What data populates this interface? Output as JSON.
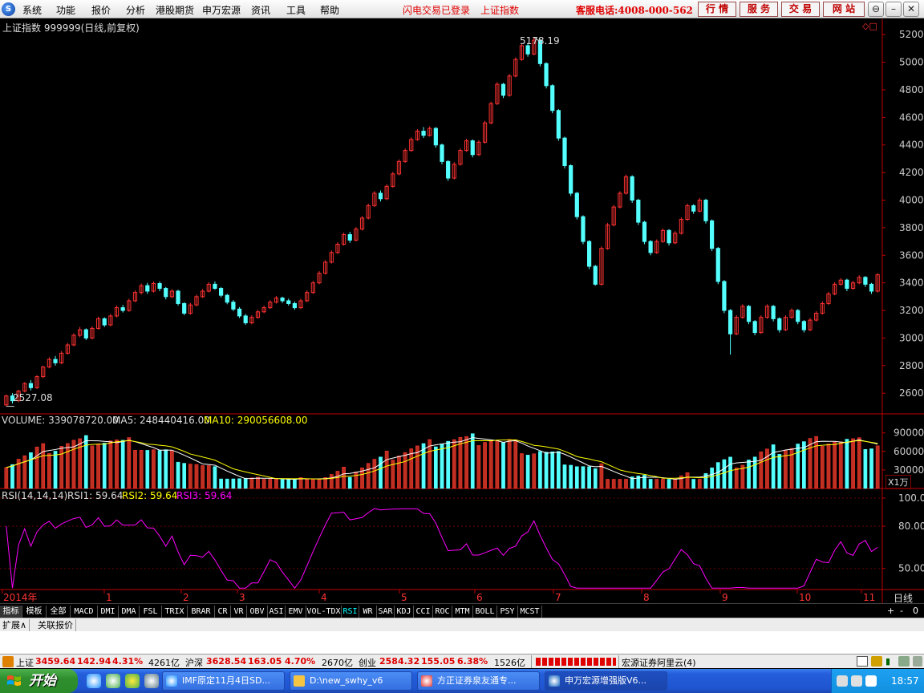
{
  "menubar": {
    "menus": [
      "系统",
      "功能",
      "报价",
      "分析",
      "港股期货",
      "申万宏源",
      "资讯",
      "工具",
      "帮助"
    ],
    "login_status": "闪电交易已登录",
    "current_symbol": "上证指数",
    "hotline": "客服电话:4008-000-562",
    "nav_buttons": [
      "行 情",
      "服 务",
      "交 易",
      "网 站"
    ]
  },
  "chart": {
    "title": "上证指数 999999(日线,前复权)",
    "high_label": "5178.19",
    "low_label": "2527.08",
    "price_ticks": [
      "5200",
      "5000",
      "4800",
      "4600",
      "4400",
      "4200",
      "4000",
      "3800",
      "3600",
      "3400",
      "3200",
      "3000",
      "2800",
      "2600"
    ],
    "volume_legend": {
      "volume": "VOLUME: 339078720.00",
      "ma5": "MA5: 248440416.00",
      "ma10": "MA10: 290056608.00"
    },
    "volume_ticks": [
      "90000",
      "60000",
      "30000"
    ],
    "volume_unit": "X1万",
    "rsi_legend": {
      "params": "RSI(14,14,14)",
      "rsi1": "RSI1: 59.64",
      "rsi2": "RSI2: 59.64",
      "rsi3": "RSI3: 59.64"
    },
    "rsi_ticks": [
      "100.00",
      "80.00",
      "50.00"
    ],
    "time_labels": [
      "2014年",
      "1",
      "2",
      "3",
      "4",
      "5",
      "6",
      "7",
      "8",
      "9",
      "10",
      "11"
    ],
    "period": "日线"
  },
  "chart_data": {
    "type": "candlestick",
    "price_range": [
      2450,
      5300
    ],
    "candles": [
      [
        2515,
        2580,
        2505,
        2590
      ],
      [
        2580,
        2545,
        2525,
        2600
      ],
      [
        2545,
        2615,
        2535,
        2625
      ],
      [
        2615,
        2670,
        2605,
        2680
      ],
      [
        2670,
        2640,
        2620,
        2695
      ],
      [
        2640,
        2720,
        2630,
        2730
      ],
      [
        2720,
        2790,
        2710,
        2800
      ],
      [
        2790,
        2845,
        2780,
        2860
      ],
      [
        2845,
        2820,
        2800,
        2870
      ],
      [
        2820,
        2890,
        2810,
        2905
      ],
      [
        2890,
        2950,
        2880,
        2965
      ],
      [
        2950,
        3020,
        2940,
        3035
      ],
      [
        3020,
        3060,
        3005,
        3080
      ],
      [
        3060,
        3000,
        2985,
        3070
      ],
      [
        3000,
        3070,
        2990,
        3085
      ],
      [
        3070,
        3140,
        3060,
        3155
      ],
      [
        3140,
        3095,
        3080,
        3150
      ],
      [
        3095,
        3160,
        3085,
        3175
      ],
      [
        3160,
        3220,
        3150,
        3235
      ],
      [
        3220,
        3200,
        3185,
        3240
      ],
      [
        3200,
        3270,
        3190,
        3285
      ],
      [
        3270,
        3330,
        3260,
        3345
      ],
      [
        3330,
        3380,
        3315,
        3395
      ],
      [
        3380,
        3340,
        3320,
        3400
      ],
      [
        3340,
        3395,
        3330,
        3410
      ],
      [
        3395,
        3360,
        3340,
        3410
      ],
      [
        3360,
        3300,
        3280,
        3370
      ],
      [
        3300,
        3340,
        3290,
        3355
      ],
      [
        3340,
        3250,
        3235,
        3350
      ],
      [
        3250,
        3180,
        3165,
        3260
      ],
      [
        3180,
        3240,
        3170,
        3255
      ],
      [
        3240,
        3300,
        3230,
        3315
      ],
      [
        3300,
        3340,
        3290,
        3355
      ],
      [
        3340,
        3390,
        3330,
        3405
      ],
      [
        3390,
        3360,
        3350,
        3410
      ],
      [
        3360,
        3310,
        3295,
        3370
      ],
      [
        3310,
        3260,
        3245,
        3320
      ],
      [
        3260,
        3210,
        3195,
        3275
      ],
      [
        3210,
        3160,
        3145,
        3225
      ],
      [
        3160,
        3110,
        3095,
        3175
      ],
      [
        3110,
        3150,
        3100,
        3165
      ],
      [
        3150,
        3190,
        3140,
        3205
      ],
      [
        3190,
        3220,
        3180,
        3235
      ],
      [
        3220,
        3260,
        3210,
        3275
      ],
      [
        3260,
        3290,
        3250,
        3305
      ],
      [
        3290,
        3270,
        3255,
        3300
      ],
      [
        3270,
        3250,
        3235,
        3285
      ],
      [
        3250,
        3220,
        3205,
        3265
      ],
      [
        3220,
        3270,
        3210,
        3285
      ],
      [
        3270,
        3330,
        3260,
        3345
      ],
      [
        3330,
        3400,
        3320,
        3415
      ],
      [
        3400,
        3470,
        3390,
        3485
      ],
      [
        3470,
        3550,
        3460,
        3565
      ],
      [
        3550,
        3620,
        3540,
        3635
      ],
      [
        3620,
        3680,
        3610,
        3695
      ],
      [
        3680,
        3750,
        3670,
        3765
      ],
      [
        3750,
        3710,
        3690,
        3770
      ],
      [
        3710,
        3790,
        3700,
        3805
      ],
      [
        3790,
        3870,
        3780,
        3885
      ],
      [
        3870,
        3960,
        3860,
        3975
      ],
      [
        3960,
        4050,
        3950,
        4065
      ],
      [
        4050,
        4010,
        3990,
        4070
      ],
      [
        4010,
        4100,
        4000,
        4115
      ],
      [
        4100,
        4190,
        4090,
        4205
      ],
      [
        4190,
        4280,
        4180,
        4295
      ],
      [
        4280,
        4360,
        4270,
        4375
      ],
      [
        4360,
        4440,
        4350,
        4455
      ],
      [
        4440,
        4500,
        4430,
        4515
      ],
      [
        4500,
        4470,
        4450,
        4530
      ],
      [
        4470,
        4520,
        4460,
        4535
      ],
      [
        4520,
        4400,
        4380,
        4530
      ],
      [
        4400,
        4280,
        4260,
        4410
      ],
      [
        4280,
        4160,
        4140,
        4290
      ],
      [
        4160,
        4260,
        4150,
        4275
      ],
      [
        4260,
        4360,
        4250,
        4375
      ],
      [
        4360,
        4430,
        4350,
        4445
      ],
      [
        4430,
        4330,
        4310,
        4440
      ],
      [
        4330,
        4420,
        4320,
        4435
      ],
      [
        4420,
        4560,
        4410,
        4575
      ],
      [
        4560,
        4700,
        4550,
        4715
      ],
      [
        4700,
        4840,
        4690,
        4855
      ],
      [
        4840,
        4760,
        4740,
        4850
      ],
      [
        4760,
        4900,
        4750,
        4915
      ],
      [
        4900,
        5020,
        4890,
        5035
      ],
      [
        5020,
        5120,
        5010,
        5135
      ],
      [
        5120,
        5060,
        5040,
        5140
      ],
      [
        5060,
        5160,
        5050,
        5178
      ],
      [
        5160,
        4990,
        4970,
        5165
      ],
      [
        4990,
        4830,
        4810,
        5000
      ],
      [
        4830,
        4650,
        4630,
        4840
      ],
      [
        4650,
        4450,
        4430,
        4660
      ],
      [
        4450,
        4250,
        4230,
        4460
      ],
      [
        4250,
        4050,
        4030,
        4260
      ],
      [
        4050,
        3880,
        3860,
        4060
      ],
      [
        3880,
        3700,
        3680,
        3890
      ],
      [
        3700,
        3520,
        3500,
        3710
      ],
      [
        3520,
        3390,
        3380,
        3530
      ],
      [
        3390,
        3650,
        3380,
        3665
      ],
      [
        3650,
        3820,
        3640,
        3835
      ],
      [
        3820,
        3950,
        3810,
        3965
      ],
      [
        3950,
        4050,
        3940,
        4065
      ],
      [
        4050,
        4170,
        4040,
        4185
      ],
      [
        4170,
        4000,
        3980,
        4180
      ],
      [
        4000,
        3840,
        3820,
        4010
      ],
      [
        3840,
        3700,
        3680,
        3850
      ],
      [
        3700,
        3620,
        3600,
        3710
      ],
      [
        3620,
        3700,
        3610,
        3715
      ],
      [
        3700,
        3780,
        3690,
        3795
      ],
      [
        3780,
        3690,
        3670,
        3790
      ],
      [
        3690,
        3760,
        3680,
        3775
      ],
      [
        3760,
        3860,
        3750,
        3875
      ],
      [
        3860,
        3960,
        3850,
        3975
      ],
      [
        3960,
        3920,
        3900,
        3970
      ],
      [
        3920,
        4000,
        3910,
        4015
      ],
      [
        4000,
        3850,
        3830,
        4010
      ],
      [
        3850,
        3650,
        3630,
        3860
      ],
      [
        3650,
        3410,
        3390,
        3660
      ],
      [
        3410,
        3200,
        3180,
        3420
      ],
      [
        3200,
        3030,
        2880,
        3210
      ],
      [
        3030,
        3150,
        3020,
        3165
      ],
      [
        3150,
        3230,
        3140,
        3245
      ],
      [
        3230,
        3120,
        3100,
        3240
      ],
      [
        3120,
        3040,
        3020,
        3130
      ],
      [
        3040,
        3150,
        3030,
        3165
      ],
      [
        3150,
        3230,
        3140,
        3245
      ],
      [
        3230,
        3140,
        3120,
        3240
      ],
      [
        3140,
        3060,
        3040,
        3150
      ],
      [
        3060,
        3150,
        3050,
        3165
      ],
      [
        3150,
        3200,
        3140,
        3215
      ],
      [
        3200,
        3120,
        3100,
        3210
      ],
      [
        3120,
        3060,
        3040,
        3130
      ],
      [
        3060,
        3130,
        3050,
        3145
      ],
      [
        3130,
        3180,
        3120,
        3195
      ],
      [
        3180,
        3250,
        3170,
        3265
      ],
      [
        3250,
        3320,
        3240,
        3335
      ],
      [
        3320,
        3390,
        3310,
        3405
      ],
      [
        3390,
        3420,
        3380,
        3435
      ],
      [
        3420,
        3360,
        3340,
        3430
      ],
      [
        3360,
        3400,
        3350,
        3415
      ],
      [
        3400,
        3440,
        3390,
        3455
      ],
      [
        3440,
        3390,
        3370,
        3450
      ],
      [
        3390,
        3340,
        3320,
        3400
      ],
      [
        3340,
        3459,
        3330,
        3470
      ]
    ]
  },
  "tabbar": {
    "tabs": [
      "指标",
      "模板",
      "全部",
      "MACD",
      "DMI",
      "DMA",
      "FSL",
      "TRIX",
      "BRAR",
      "CR",
      "VR",
      "OBV",
      "ASI",
      "EMV",
      "VOL-TDX",
      "RSI",
      "WR",
      "SAR",
      "KDJ",
      "CCI",
      "ROC",
      "MTM",
      "BOLL",
      "PSY",
      "MCST"
    ],
    "controls": [
      "+",
      "-",
      "0"
    ]
  },
  "extbar": {
    "tabs": [
      "扩展∧",
      "关联报价"
    ]
  },
  "statusbar": {
    "sh_name": "上证",
    "sh_value": "3459.64",
    "sh_change": "142.94",
    "sh_pct": "4.31%",
    "sh_amount": "4261亿",
    "hs_name": "沪深",
    "hs_value": "3628.54",
    "hs_change": "163.05",
    "hs_pct": "4.70%",
    "hs_amount": "2670亿",
    "cy_name": "创业",
    "cy_value": "2584.32",
    "cy_change": "155.05",
    "cy_pct": "6.38%",
    "cy_amount": "1526亿",
    "server": "宏源证券阿里云(4)"
  },
  "taskbar": {
    "start": "开始",
    "tasks": [
      "IMF原定11月4日SD...",
      "D:\\new_swhy_v6",
      "方正证券泉友通专...",
      "申万宏源增强版V6..."
    ],
    "clock": "18:57"
  },
  "colors": {
    "up": "#ff3232",
    "down": "#54ffff",
    "ma10": "#ffff00",
    "rsi": "#ff00ff",
    "axis": "#c00000"
  }
}
